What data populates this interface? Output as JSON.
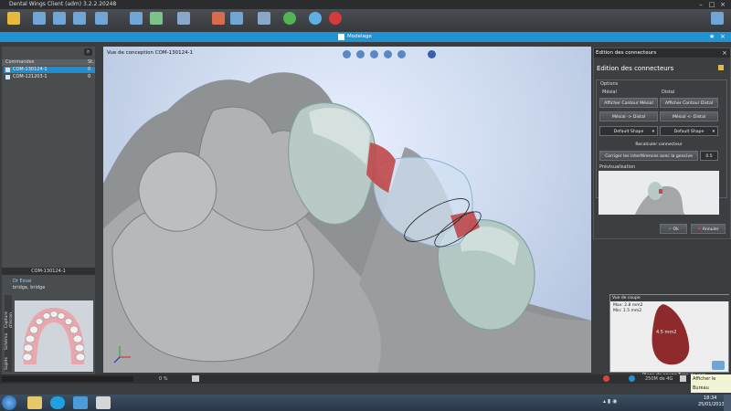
{
  "window": {
    "title": "Dental Wings Client (adm)   3.2.2.20248"
  },
  "modebar": {
    "label": "Modelage"
  },
  "left": {
    "col_commandes": "Commandes",
    "col_st": "St.",
    "orders": [
      {
        "id": "COM-130124-1",
        "st": "0"
      },
      {
        "id": "COM-121203-1",
        "st": "0"
      }
    ],
    "detail_header": "COM-130124-1",
    "doctor": "Dr Essai",
    "type": "bridge, bridge",
    "side_tabs": [
      "Capture d'écran",
      "Schéma",
      "Sujets"
    ]
  },
  "viewport": {
    "title": "Vue de conception   COM-130124-1"
  },
  "right": {
    "panel_title": "Edition des connecteurs",
    "header": "Edition des connecteurs",
    "options": "Options",
    "mesial": "Mésial",
    "distal": "Distal",
    "btn_show_mesial": "Afficher Contour Mésial",
    "btn_show_distal": "Afficher Contour Distal",
    "btn_mesial_to_distal": "Mésial -> Distal",
    "btn_mesial_from_distal": "Mésial <- Distal",
    "shape_mesial": "Default Shape",
    "shape_distal": "Default Shape",
    "btn_recalc": "Recalculer connecteur",
    "btn_correct": "Corriger les interférences avec la gencive",
    "correct_value": "0.5",
    "preview": "Prévisualisation",
    "ok": "Ok",
    "cancel": "Annuler"
  },
  "section": {
    "title": "Vue de coupe",
    "max": "Max: 2.8 mm2",
    "min": "Min: 1.5 mm2",
    "area": "4.5 mm2",
    "plane_label": "Plans de coupe",
    "type_label": "Type de vue"
  },
  "status": {
    "progress": "0 %",
    "memory": "250M de 4G",
    "show_desktop": "Afficher le Bureau",
    "time": "18:34",
    "date": "25/01/2013"
  },
  "colors": {
    "accent": "#1f93d4",
    "connector": "#c0484a",
    "section_fill": "#8e2a2c"
  }
}
